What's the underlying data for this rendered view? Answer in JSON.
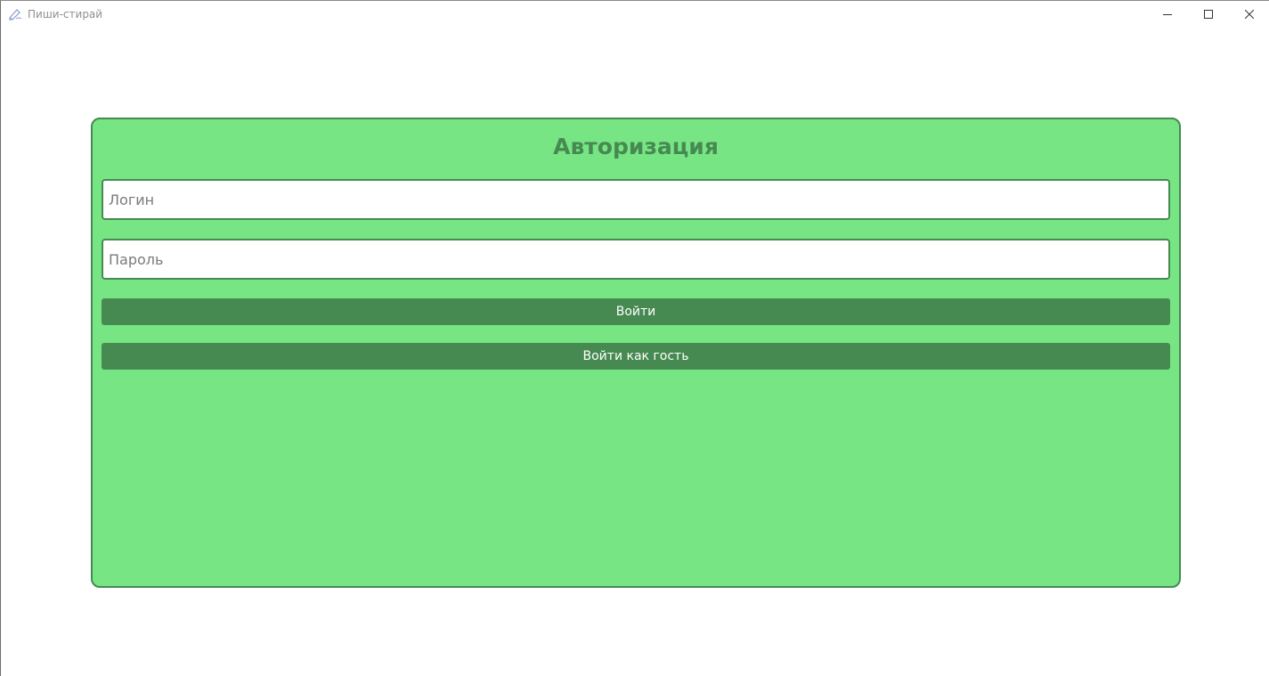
{
  "window": {
    "title": "Пиши-стирай",
    "app_icon": "pencil-eraser-icon",
    "controls": {
      "minimize_icon": "minimize-icon",
      "maximize_icon": "maximize-icon",
      "close_icon": "close-icon"
    }
  },
  "auth": {
    "title": "Авторизация",
    "login": {
      "value": "",
      "placeholder": "Логин"
    },
    "password": {
      "value": "",
      "placeholder": "Пароль"
    },
    "login_button_label": "Войти",
    "guest_button_label": "Войти как гость"
  },
  "colors": {
    "panel_background": "#77e583",
    "accent": "#468a51",
    "button_text": "#ffffff"
  }
}
